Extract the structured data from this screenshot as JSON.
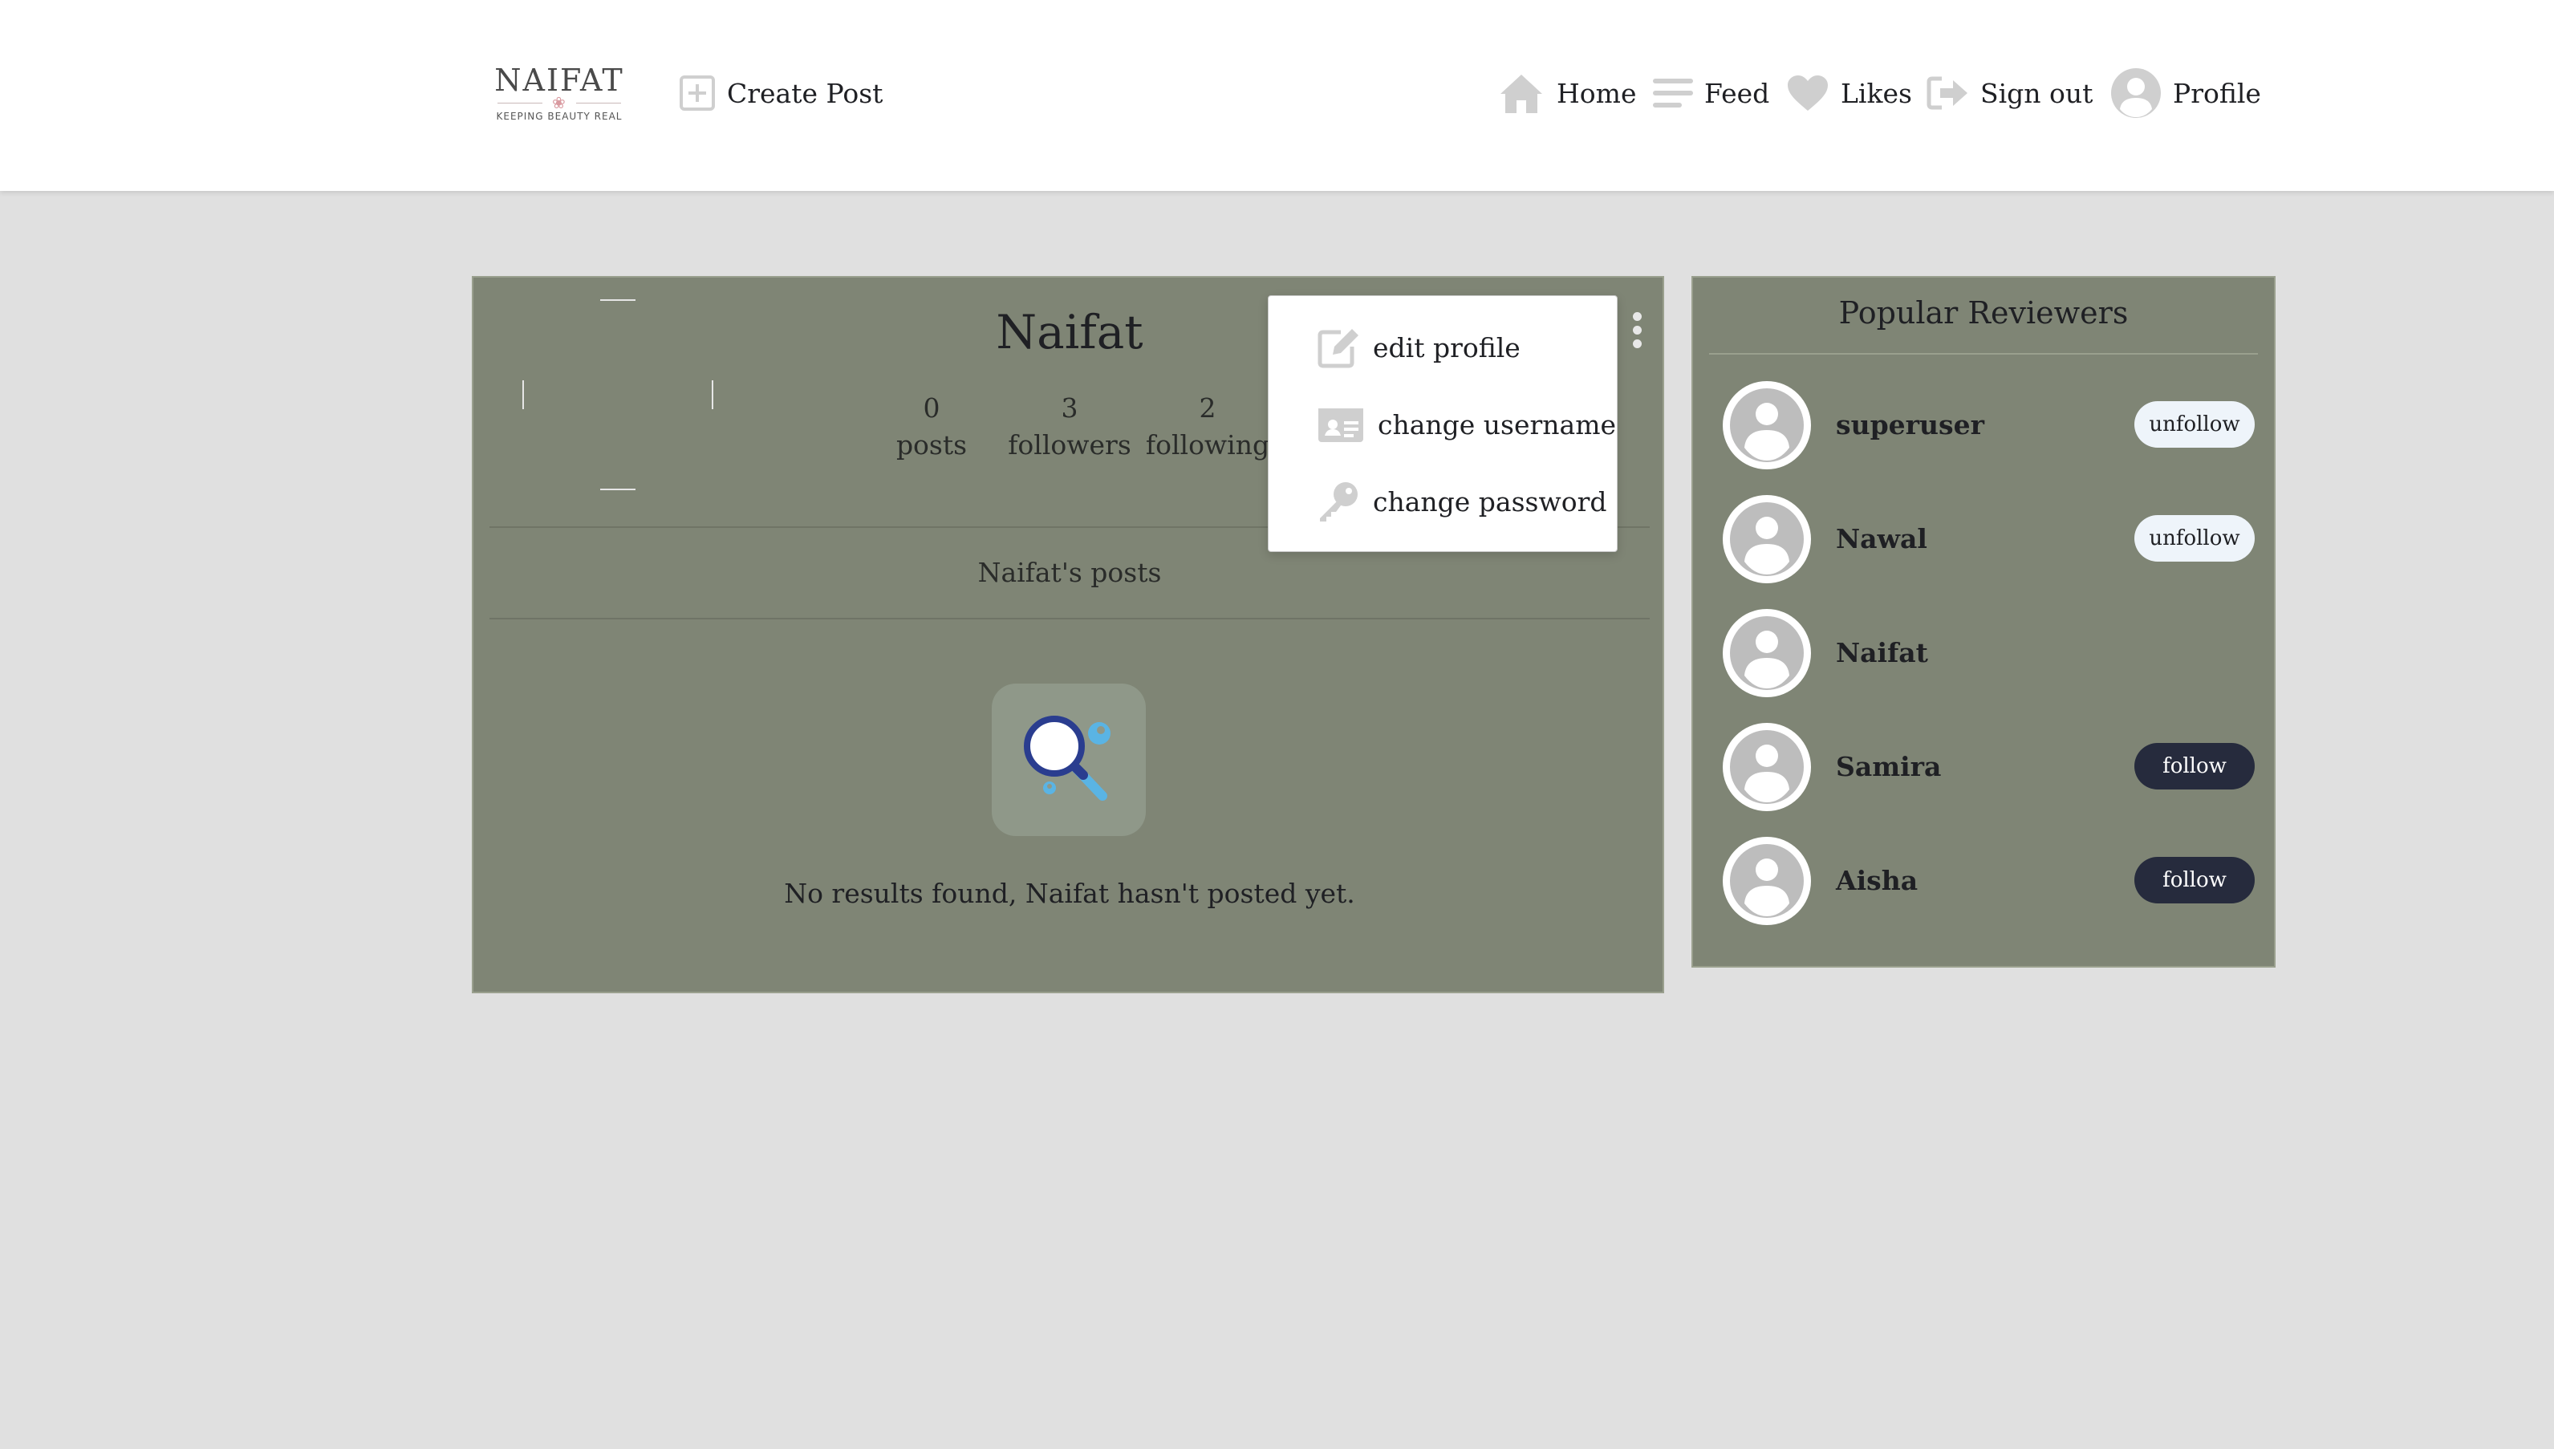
{
  "brand": {
    "name": "NAIFAT",
    "tagline": "KEEPING BEAUTY REAL"
  },
  "nav": {
    "create_post": "Create Post",
    "home": "Home",
    "feed": "Feed",
    "likes": "Likes",
    "sign_out": "Sign out",
    "profile": "Profile"
  },
  "profile": {
    "name": "Naifat",
    "stats": [
      {
        "value": "0",
        "label": "posts"
      },
      {
        "value": "3",
        "label": "followers"
      },
      {
        "value": "2",
        "label": "following"
      }
    ],
    "posts_heading": "Naifat's posts",
    "empty_message": "No results found, Naifat hasn't posted yet."
  },
  "menu": {
    "edit_profile": "edit profile",
    "change_username": "change username",
    "change_password": "change password"
  },
  "sidebar": {
    "title": "Popular Reviewers",
    "reviewers": [
      {
        "name": "superuser",
        "action": "unfollow"
      },
      {
        "name": "Nawal",
        "action": "unfollow"
      },
      {
        "name": "Naifat",
        "action": ""
      },
      {
        "name": "Samira",
        "action": "follow"
      },
      {
        "name": "Aisha",
        "action": "follow"
      }
    ]
  },
  "colors": {
    "card_bg": "#7f8575",
    "page_bg": "#e0e0e0",
    "follow_btn": "#262b3d",
    "unfollow_btn": "#eef4fa",
    "icon_gray": "#cfcfcf"
  }
}
